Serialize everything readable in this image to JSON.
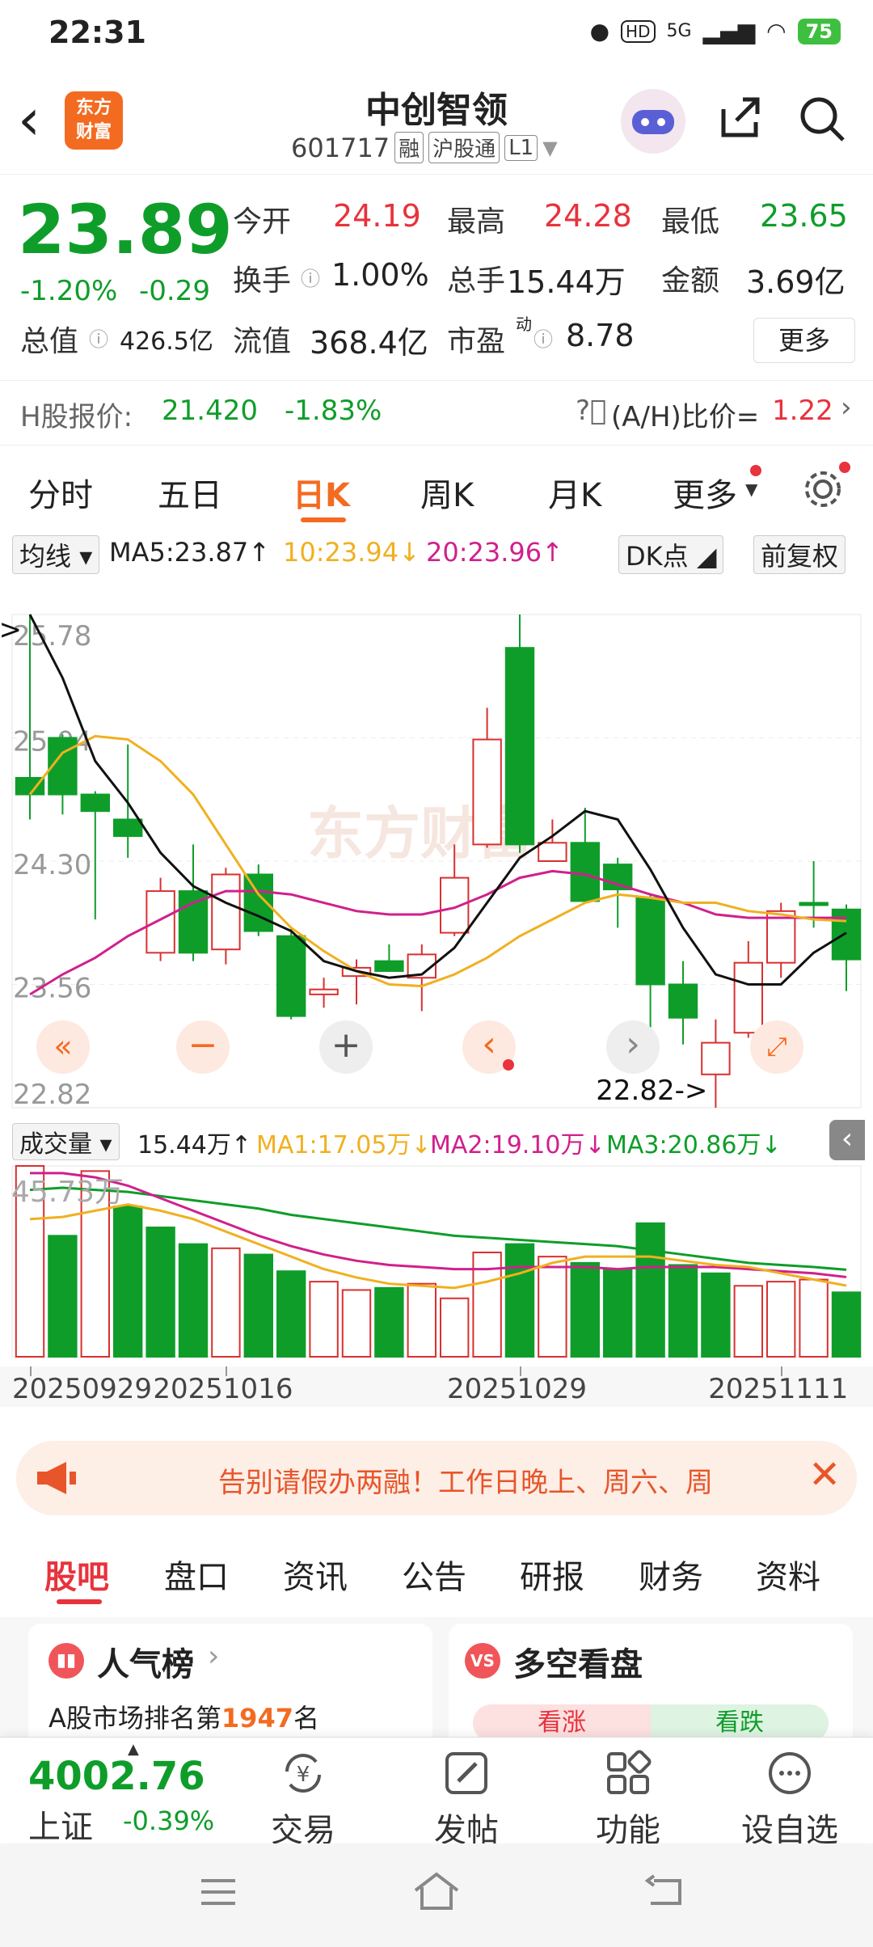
{
  "status_bar": {
    "time": "22:31",
    "network": "5G",
    "battery": "75",
    "hd": "HD"
  },
  "header": {
    "logo_line1": "东方",
    "logo_line2": "财富",
    "name": "中创智领",
    "code": "601717",
    "tags": [
      "融",
      "沪股通",
      "L1"
    ]
  },
  "quote": {
    "price": "23.89",
    "change_pct": "-1.20%",
    "change": "-0.29",
    "open_label": "今开",
    "open": "24.19",
    "high_label": "最高",
    "high": "24.28",
    "low_label": "最低",
    "low": "23.65",
    "turnover_label": "换手",
    "turnover": "1.00%",
    "volume_label": "总手",
    "volume": "15.44万",
    "amount_label": "金额",
    "amount": "3.69亿",
    "mktcap_label": "总值",
    "mktcap": "426.5亿",
    "float_label": "流值",
    "float": "368.4亿",
    "pe_label": "市盈",
    "pe_sup": "动",
    "pe": "8.78",
    "more_label": "更多"
  },
  "h_share": {
    "label": "H股报价:",
    "price": "21.420",
    "chg": "-1.83%",
    "ratio_label": "(A/H)比价=",
    "ratio": "1.22"
  },
  "chart_tabs": [
    "分时",
    "五日",
    "日K",
    "周K",
    "月K",
    "更多"
  ],
  "active_tab": "日K",
  "ma_row": {
    "dropdown": "均线",
    "ma5": "MA5:23.87↑",
    "ma10": "10:23.94↓",
    "ma20": "20:23.96↑",
    "dk": "DK点",
    "adj": "前复权"
  },
  "chart_data": {
    "type": "candlestick",
    "y_ticks": [
      "25.78",
      "25.04",
      "24.30",
      "23.56",
      "22.82"
    ],
    "ylim": [
      22.82,
      25.78
    ],
    "max_marker": "25.78->",
    "min_marker": "22.82->",
    "watermark": "东方财富",
    "candles": [
      {
        "o": 24.8,
        "c": 24.7,
        "h": 25.78,
        "l": 24.55,
        "up": false
      },
      {
        "o": 25.04,
        "c": 24.7,
        "h": 25.06,
        "l": 24.58,
        "up": false
      },
      {
        "o": 24.7,
        "c": 24.6,
        "h": 24.72,
        "l": 23.95,
        "up": false
      },
      {
        "o": 24.55,
        "c": 24.45,
        "h": 25.0,
        "l": 24.32,
        "up": false
      },
      {
        "o": 23.75,
        "c": 24.12,
        "h": 24.2,
        "l": 23.7,
        "up": true
      },
      {
        "o": 24.12,
        "c": 23.75,
        "h": 24.4,
        "l": 23.7,
        "up": false
      },
      {
        "o": 23.77,
        "c": 24.22,
        "h": 24.26,
        "l": 23.68,
        "up": true
      },
      {
        "o": 24.22,
        "c": 23.88,
        "h": 24.28,
        "l": 23.85,
        "up": false
      },
      {
        "o": 23.85,
        "c": 23.37,
        "h": 23.9,
        "l": 23.35,
        "up": false
      },
      {
        "o": 23.5,
        "c": 23.53,
        "h": 23.6,
        "l": 23.42,
        "up": true
      },
      {
        "o": 23.61,
        "c": 23.66,
        "h": 23.71,
        "l": 23.44,
        "up": true
      },
      {
        "o": 23.7,
        "c": 23.64,
        "h": 23.8,
        "l": 23.64,
        "up": false
      },
      {
        "o": 23.6,
        "c": 23.74,
        "h": 23.8,
        "l": 23.4,
        "up": true
      },
      {
        "o": 23.87,
        "c": 24.2,
        "h": 24.4,
        "l": 23.85,
        "up": true
      },
      {
        "o": 24.4,
        "c": 25.03,
        "h": 25.22,
        "l": 24.38,
        "up": true
      },
      {
        "o": 24.4,
        "c": 25.58,
        "h": 25.78,
        "l": 24.35,
        "up": false
      },
      {
        "o": 24.3,
        "c": 24.41,
        "h": 24.55,
        "l": 24.3,
        "up": true
      },
      {
        "o": 24.41,
        "c": 24.06,
        "h": 24.62,
        "l": 24.06,
        "up": false
      },
      {
        "o": 24.28,
        "c": 24.13,
        "h": 24.32,
        "l": 23.9,
        "up": false
      },
      {
        "o": 24.08,
        "c": 23.56,
        "h": 24.1,
        "l": 23.15,
        "up": false
      },
      {
        "o": 23.56,
        "c": 23.36,
        "h": 23.7,
        "l": 23.2,
        "up": false
      },
      {
        "o": 23.02,
        "c": 23.21,
        "h": 23.35,
        "l": 22.82,
        "up": true
      },
      {
        "o": 23.27,
        "c": 23.69,
        "h": 23.82,
        "l": 23.24,
        "up": true
      },
      {
        "o": 23.69,
        "c": 24.0,
        "h": 24.05,
        "l": 23.6,
        "up": true
      },
      {
        "o": 24.05,
        "c": 24.05,
        "h": 24.3,
        "l": 23.9,
        "up": false
      },
      {
        "o": 24.01,
        "c": 23.71,
        "h": 24.04,
        "l": 23.52,
        "up": false
      }
    ],
    "ma5": [
      25.78,
      25.4,
      24.9,
      24.65,
      24.35,
      24.15,
      24.05,
      23.97,
      23.88,
      23.7,
      23.64,
      23.6,
      23.62,
      23.78,
      24.05,
      24.32,
      24.45,
      24.6,
      24.55,
      24.25,
      23.9,
      23.62,
      23.56,
      23.56,
      23.75,
      23.87
    ],
    "ma10": [
      24.7,
      24.95,
      25.05,
      25.03,
      24.9,
      24.7,
      24.4,
      24.1,
      23.9,
      23.76,
      23.64,
      23.56,
      23.55,
      23.62,
      23.72,
      23.85,
      23.95,
      24.05,
      24.1,
      24.08,
      24.05,
      24.05,
      24.0,
      23.98,
      23.95,
      23.94
    ],
    "ma20": [
      23.5,
      23.62,
      23.72,
      23.85,
      23.95,
      24.05,
      24.12,
      24.12,
      24.1,
      24.05,
      24.0,
      23.98,
      23.98,
      24.02,
      24.1,
      24.2,
      24.24,
      24.22,
      24.16,
      24.1,
      24.05,
      23.98,
      23.96,
      23.96,
      23.96,
      23.96
    ],
    "x_labels": [
      "20250929",
      "20251016",
      "20251029",
      "20251111"
    ],
    "x_label_index": [
      0,
      6,
      15,
      23
    ]
  },
  "volume_row": {
    "dropdown": "成交量",
    "total": "15.44万↑",
    "ma1": "MA1:17.05万↓",
    "ma2": "MA2:19.10万↓",
    "ma3": "MA3:20.86万↓"
  },
  "volume_data": {
    "max_label": "45.73万",
    "max": 45.73,
    "values": [
      45.73,
      29.0,
      44.5,
      36.0,
      31.0,
      27.0,
      26.0,
      24.5,
      20.5,
      18.0,
      16.0,
      16.5,
      17.5,
      14.0,
      25.0,
      27.0,
      24.0,
      22.5,
      21.0,
      32.0,
      22.0,
      20.0,
      17.0,
      18.0,
      18.5,
      15.44
    ],
    "up": [
      true,
      false,
      true,
      false,
      false,
      false,
      true,
      false,
      false,
      true,
      true,
      false,
      true,
      true,
      true,
      false,
      true,
      false,
      false,
      false,
      false,
      false,
      true,
      true,
      true,
      false
    ],
    "ma1": [
      33.0,
      33.5,
      35.0,
      36.5,
      35.0,
      33.0,
      30.0,
      27.0,
      24.0,
      21.0,
      19.0,
      17.5,
      17.0,
      16.5,
      18.0,
      20.0,
      22.5,
      24.0,
      24.0,
      24.0,
      23.0,
      22.0,
      21.5,
      20.0,
      18.5,
      17.05
    ],
    "ma2": [
      44.0,
      44.0,
      43.0,
      41.0,
      38.0,
      35.0,
      32.0,
      29.0,
      26.5,
      24.5,
      23.0,
      22.0,
      21.5,
      21.0,
      21.0,
      21.5,
      21.5,
      21.5,
      21.0,
      21.5,
      21.5,
      21.5,
      21.0,
      20.5,
      20.0,
      19.1
    ],
    "ma3": [
      40.0,
      40.5,
      40.0,
      39.5,
      38.5,
      37.5,
      36.5,
      35.5,
      34.0,
      33.0,
      32.0,
      31.0,
      30.0,
      29.0,
      28.5,
      28.0,
      27.5,
      27.0,
      26.5,
      25.5,
      24.5,
      23.5,
      22.5,
      22.0,
      21.5,
      20.86
    ]
  },
  "banner": {
    "text": "告别请假办两融！工作日晚上、周六、周"
  },
  "bottom_tabs": [
    "股吧",
    "盘口",
    "资讯",
    "公告",
    "研报",
    "财务",
    "资料"
  ],
  "cards": {
    "popularity_title": "人气榜",
    "popularity_text_prefix": "A股市场排名第",
    "popularity_rank": "1947",
    "popularity_text_suffix": "名",
    "duokong_title": "多空看盘",
    "bull_label": "看涨",
    "bear_label": "看跌"
  },
  "index": {
    "value": "4002.76",
    "name": "上证",
    "chg": "-0.39%"
  },
  "bottom_nav": [
    "交易",
    "发帖",
    "功能",
    "设自选"
  ]
}
